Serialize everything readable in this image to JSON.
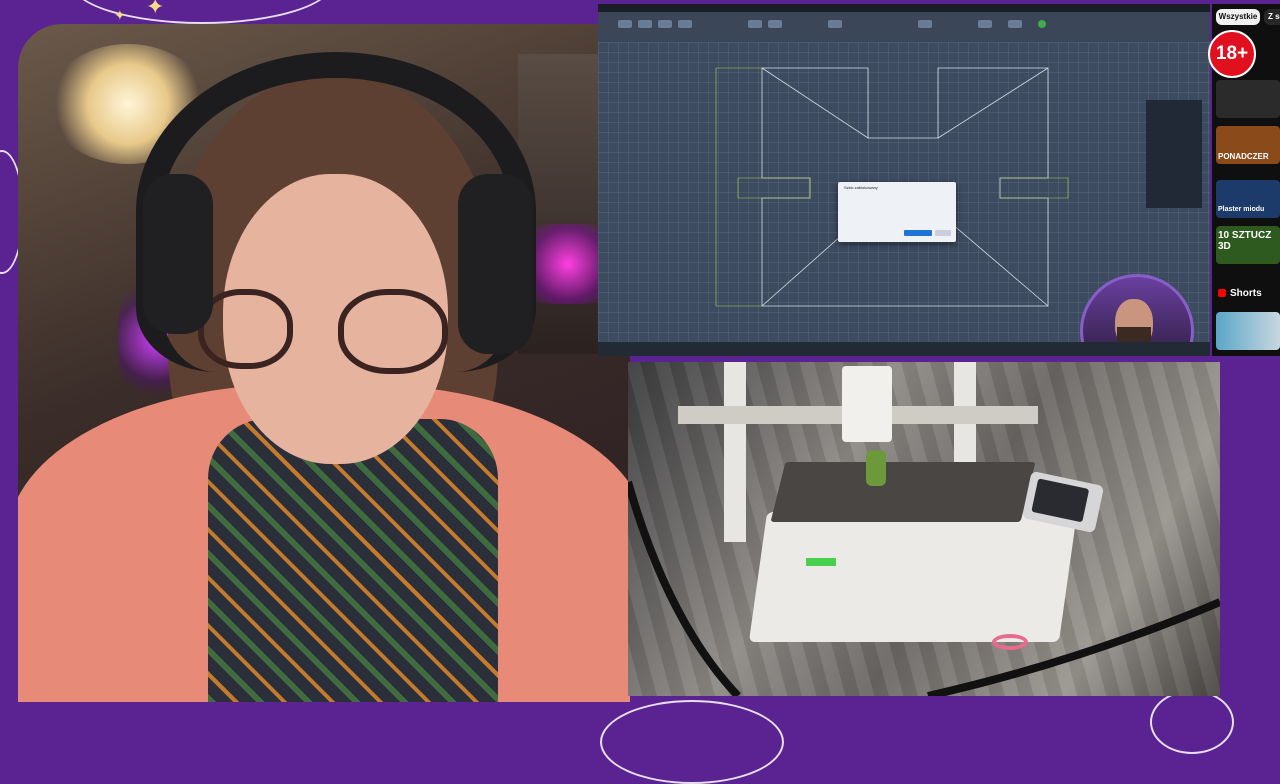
{
  "layout_name": "stream-overlay",
  "overlay": {
    "background_color": "#5a2391",
    "accent_color": "#f7d98a"
  },
  "webcam": {
    "label": "streamer webcam"
  },
  "screen_share": {
    "app": "fusion-3d-cad",
    "canvas_color": "#3c4b60",
    "dialog": {
      "title": "Szkic zablokowany",
      "ok_label": "",
      "cancel_label": ""
    }
  },
  "youtube_sidebar": {
    "chips": [
      "Wszystkie",
      "Z se"
    ],
    "age_badge": "18+",
    "thumbnails": [
      {
        "caption": "",
        "color": "#2b2b2b"
      },
      {
        "caption": "",
        "color": "#3a2a1a"
      },
      {
        "caption": "PONADCZER",
        "color": "#7a3a1a"
      },
      {
        "caption": "Plaster miodu",
        "color": "#1d3b6a"
      },
      {
        "caption": "10 SZTUCZ 3D",
        "color": "#2f5a1f"
      }
    ],
    "shorts_label": "Shorts"
  },
  "printer_cam": {
    "label": "Bambu Lab printer"
  }
}
